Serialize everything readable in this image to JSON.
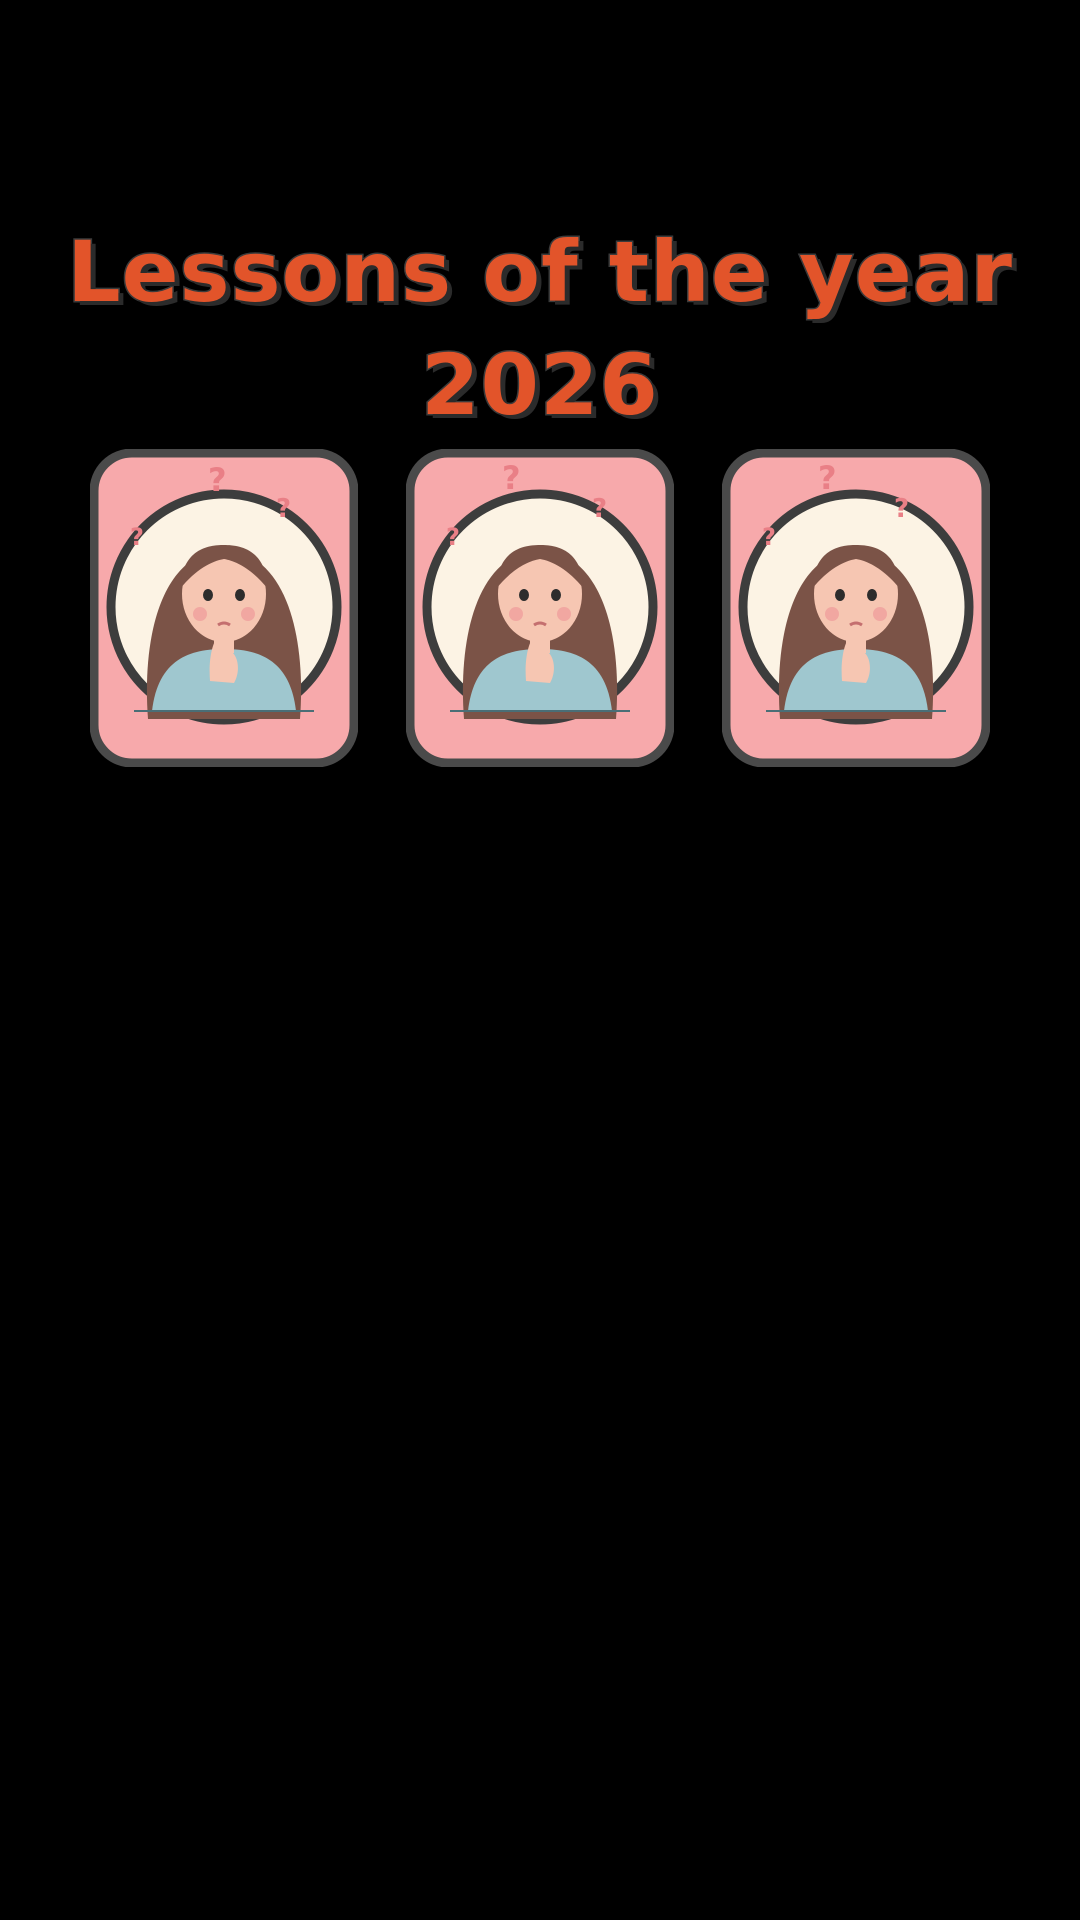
{
  "title": {
    "line1": "Lessons of the year",
    "line2": "2026"
  },
  "cards": [
    {
      "illustration": "thinking-girl-icon"
    },
    {
      "illustration": "thinking-girl-icon"
    },
    {
      "illustration": "thinking-girl-icon"
    }
  ],
  "colors": {
    "background": "#000000",
    "title_fill": "#e2542a",
    "title_outline": "#3b3b3b",
    "card_pink": "#f7a9ab",
    "card_frame": "#4a4a4a",
    "circle_bg": "#fcf3e4",
    "hair": "#7b5347",
    "sweater": "#9fc7cf",
    "question_mark": "#e97f86"
  }
}
